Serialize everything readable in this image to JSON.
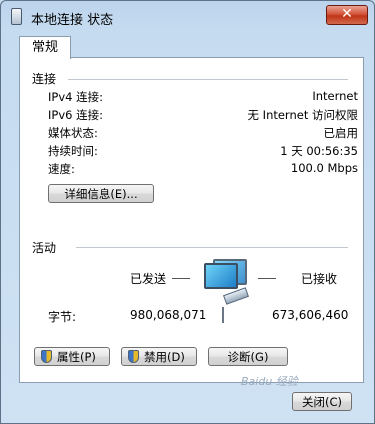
{
  "window": {
    "title": "本地连接 状态",
    "close_glyph": "✕"
  },
  "tab": {
    "label": "常规"
  },
  "connection": {
    "section_label": "连接",
    "rows": [
      {
        "label": "IPv4 连接:",
        "value": "Internet"
      },
      {
        "label": "IPv6 连接:",
        "value": "无 Internet 访问权限"
      },
      {
        "label": "媒体状态:",
        "value": "已启用"
      },
      {
        "label": "持续时间:",
        "value": "1 天 00:56:35"
      },
      {
        "label": "速度:",
        "value": "100.0 Mbps"
      }
    ],
    "details_button": "详细信息(E)..."
  },
  "activity": {
    "section_label": "活动",
    "sent_label": "已发送",
    "received_label": "已接收",
    "bytes_label": "字节:",
    "bytes_sent": "980,068,071",
    "bytes_received": "673,606,460"
  },
  "buttons": {
    "properties": "属性(P)",
    "disable": "禁用(D)",
    "diagnose": "诊断(G)",
    "close": "关闭(C)"
  },
  "watermark": "Baidu 经验",
  "icons": [
    "window-icon",
    "shield-icon",
    "network-icon"
  ]
}
